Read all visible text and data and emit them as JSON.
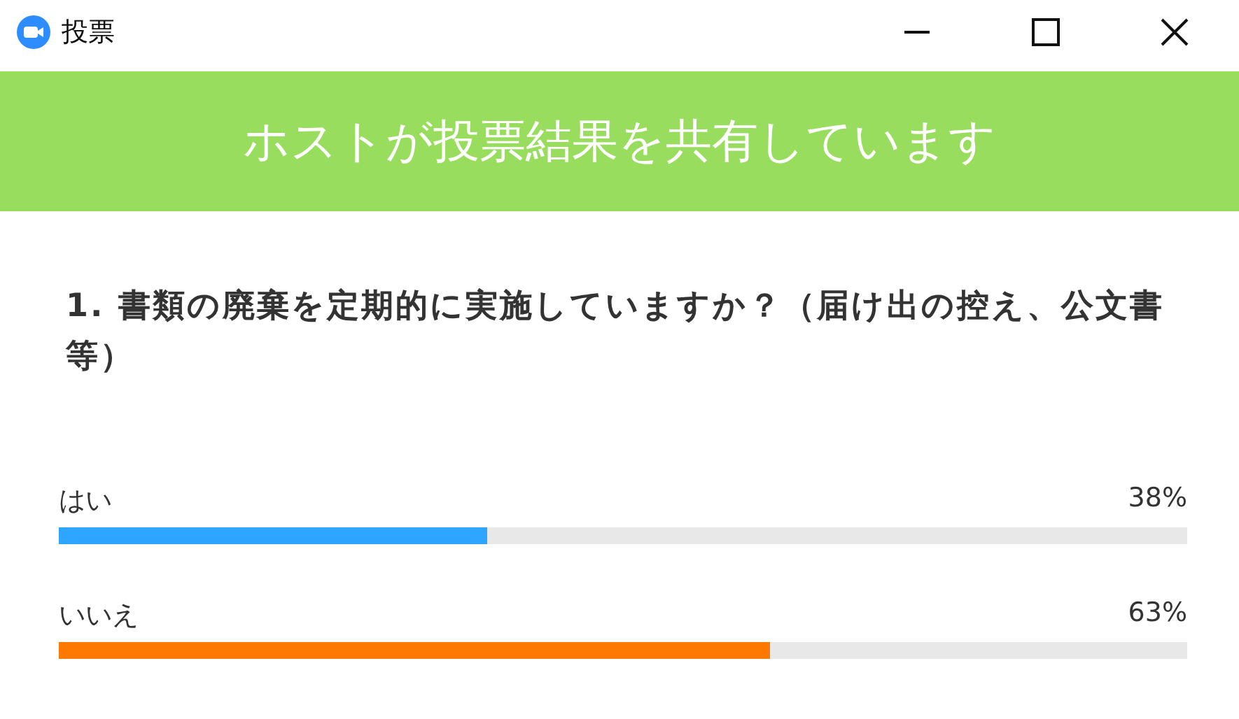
{
  "window": {
    "title": "投票"
  },
  "banner": {
    "text": "ホストが投票結果を共有しています"
  },
  "question": {
    "number": "1.",
    "text": "書類の廃棄を定期的に実施していますか？（届け出の控え、公文書等）"
  },
  "options": [
    {
      "label": "はい",
      "reading": "38%",
      "level": 0.38,
      "color": "#2ea6ff"
    },
    {
      "label": "いいえ",
      "reading": "63%",
      "level": 0.63,
      "color": "#ff7800"
    }
  ]
}
